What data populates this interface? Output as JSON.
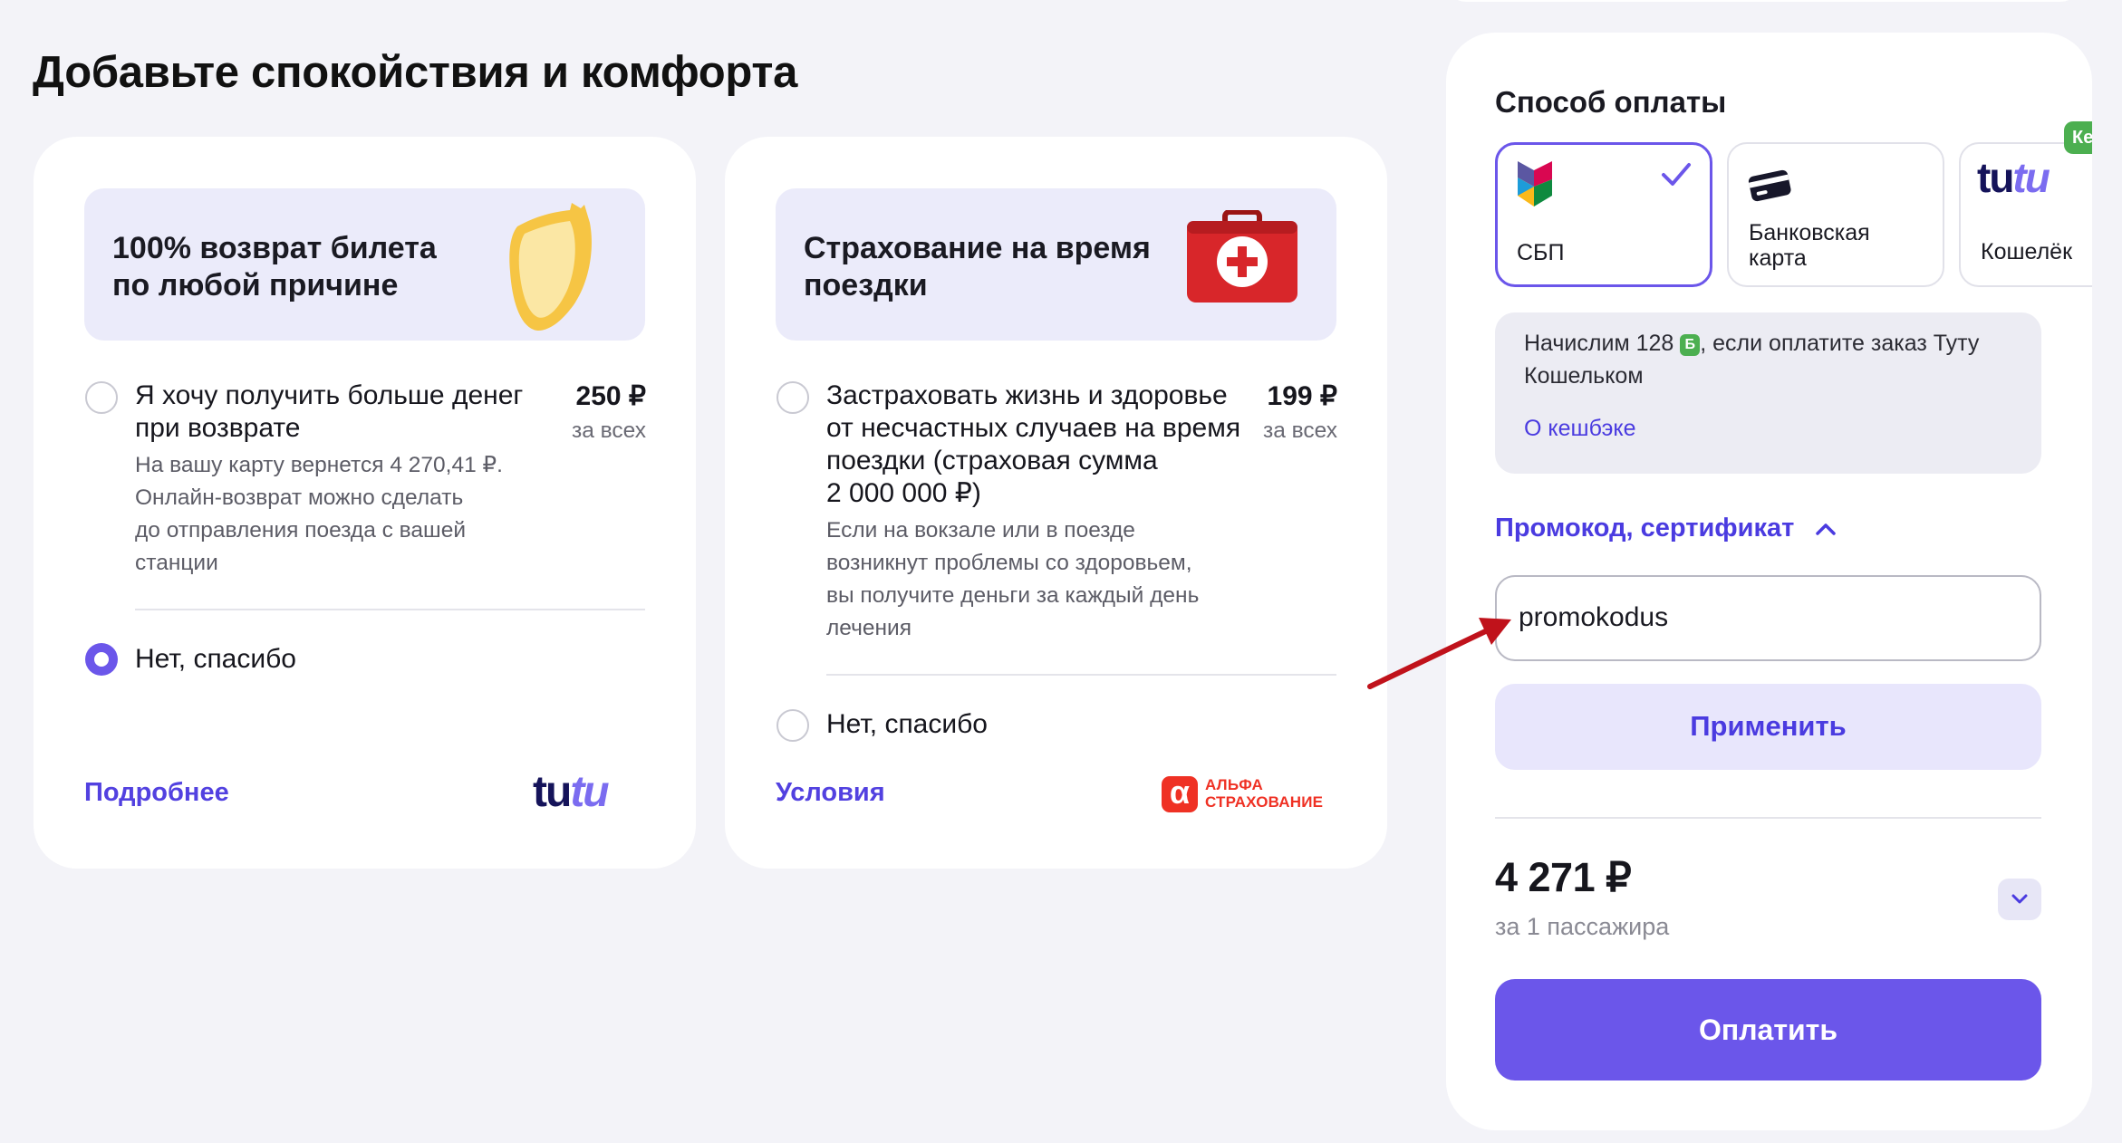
{
  "page": {
    "title": "Добавьте спокойствия и комфорта"
  },
  "refund_card": {
    "banner_title_line1": "100% возврат билета",
    "banner_title_line2": "по любой причине",
    "option_label_line1": "Я хочу получить больше денег",
    "option_label_line2": "при возврате",
    "option_desc_line1": "На вашу карту вернется 4 270,41 ₽.",
    "option_desc_line2": "Онлайн-возврат можно сделать",
    "option_desc_line3": "до отправления поезда с вашей",
    "option_desc_line4": "станции",
    "price": "250 ₽",
    "price_sub": "за всех",
    "decline_label": "Нет, спасибо",
    "decline_selected": true,
    "more_link": "Подробнее",
    "logo_text_a": "tu",
    "logo_text_b": "tu"
  },
  "insurance_card": {
    "banner_title_line1": "Страхование на время",
    "banner_title_line2": "поездки",
    "option_label_line1": "Застраховать жизнь и здоровье",
    "option_label_line2": "от несчастных случаев на время",
    "option_label_line3": "поездки (страховая сумма",
    "option_label_line4": "2 000 000 ₽)",
    "option_desc_line1": "Если на вокзале или в поезде",
    "option_desc_line2": "возникнут проблемы со здоровьем,",
    "option_desc_line3": "вы получите деньги за каждый день",
    "option_desc_line4": "лечения",
    "price": "199 ₽",
    "price_sub": "за всех",
    "decline_label": "Нет, спасибо",
    "decline_selected": false,
    "terms_link": "Условия",
    "partner_logo_line1": "АЛЬФА",
    "partner_logo_line2": "СТРАХОВАНИЕ"
  },
  "payment": {
    "title": "Способ оплаты",
    "methods": [
      {
        "label": "СБП",
        "selected": true
      },
      {
        "label": "Банковская карта",
        "label_line1": "Банковская",
        "label_line2": "карта",
        "selected": false
      },
      {
        "label": "Кошелёк",
        "logo_a": "tu",
        "logo_b": "tu",
        "badge": "Ке",
        "selected": false
      }
    ],
    "cashback_text_before": "Начислим 128",
    "cashback_badge": "Б",
    "cashback_text_after": ", если оплатите заказ Туту",
    "cashback_text_line2": "Кошельком",
    "cashback_link": "О кешбэке",
    "promo_toggle": "Промокод, сертификат",
    "promo_value": "promokodus",
    "apply_label": "Применить",
    "total": "4 271 ₽",
    "total_sub": "за 1 пассажира",
    "pay_label": "Оплатить"
  },
  "colors": {
    "accent": "#6b56ea",
    "link": "#4a3be0",
    "background": "#f3f3f8",
    "alfa_red": "#ef3124",
    "tutu_dark": "#15135a",
    "tutu_light": "#7b6cf0",
    "annotation_arrow": "#c0121b"
  },
  "icons": [
    "shield-icon",
    "first-aid-kit-icon",
    "sbp-icon",
    "check-icon",
    "bank-card-icon",
    "chevron-up-icon",
    "chevron-down-icon",
    "annotation-arrow-icon"
  ]
}
